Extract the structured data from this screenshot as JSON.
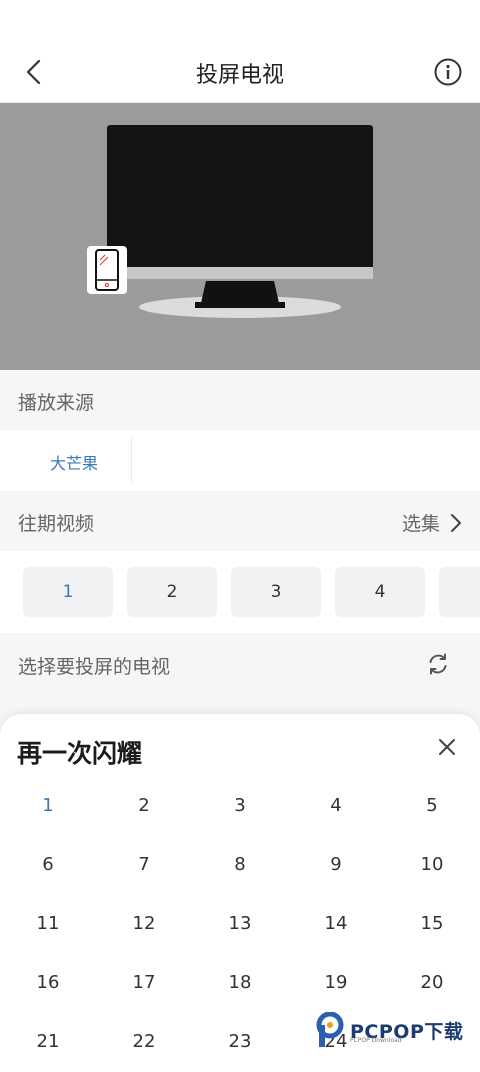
{
  "header": {
    "title": "投屏电视"
  },
  "sections": {
    "source": "播放来源",
    "past_videos": "往期视频",
    "select_episodes": "选集",
    "choose_tv": "选择要投屏的电视"
  },
  "sources": [
    "大芒果"
  ],
  "episodes": [
    "1",
    "2",
    "3",
    "4"
  ],
  "selected_episode": "1",
  "sheet": {
    "title": "再一次闪耀",
    "episodes": [
      "1",
      "2",
      "3",
      "4",
      "5",
      "6",
      "7",
      "8",
      "9",
      "10",
      "11",
      "12",
      "13",
      "14",
      "15",
      "16",
      "17",
      "18",
      "19",
      "20",
      "21",
      "22",
      "23",
      "24"
    ]
  },
  "watermark": {
    "brand": "PCPOP下载",
    "sub": "PCPOP Download"
  },
  "colors": {
    "accent": "#3b78b8",
    "stage_bg": "#9c9c9c",
    "page_bg": "#f5f6f8"
  }
}
